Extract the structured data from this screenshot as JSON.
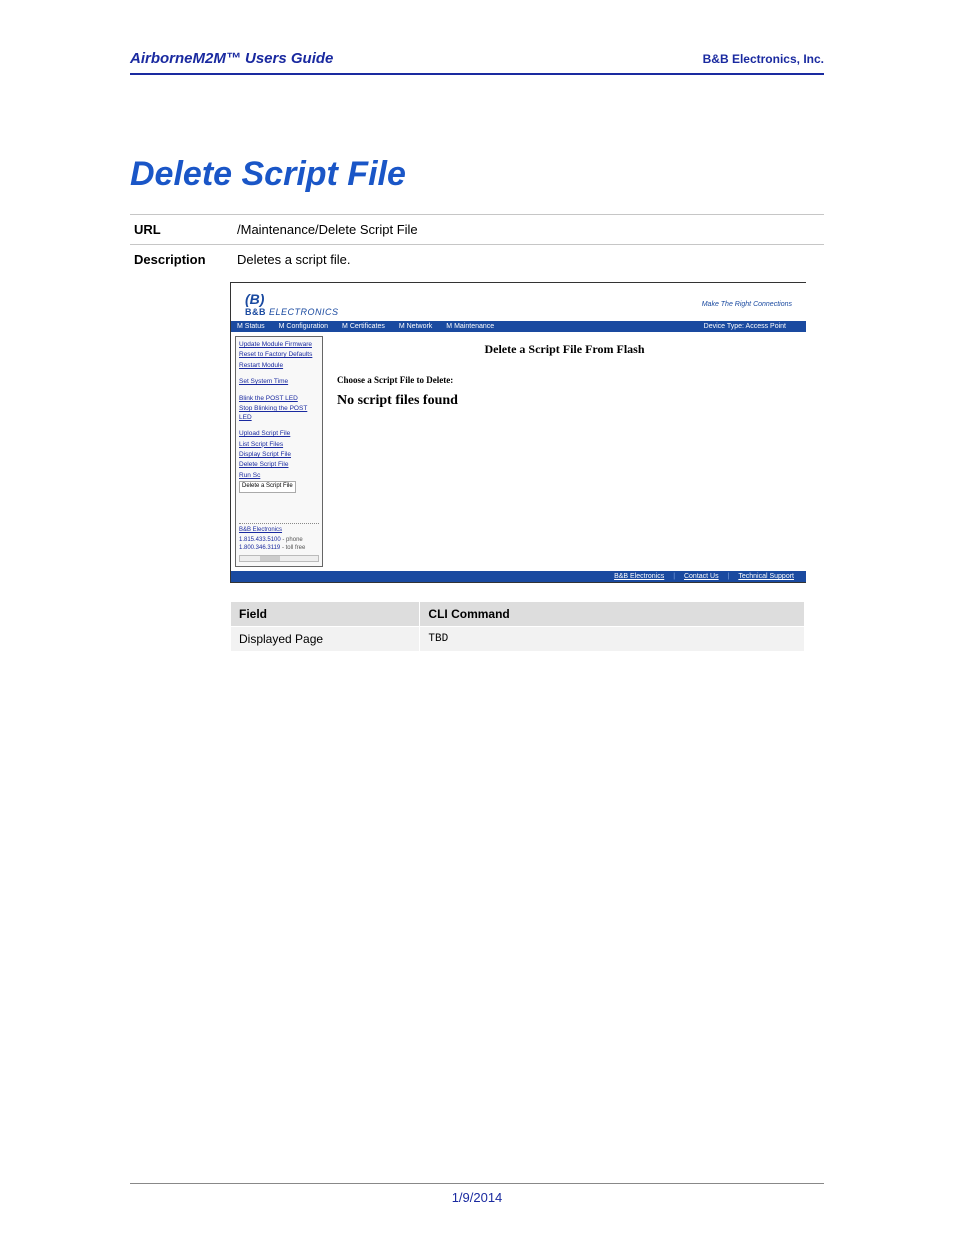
{
  "header": {
    "left": "AirborneM2M™ Users Guide",
    "right": "B&B Electronics, Inc."
  },
  "section_title": "Delete Script File",
  "info_rows": {
    "url": {
      "label": "URL",
      "value": "/Maintenance/Delete Script File"
    },
    "desc": {
      "label": "Description",
      "value": "Deletes a script file."
    }
  },
  "embedded": {
    "logo_b": "(B)",
    "logo_text_a": "B&B",
    "logo_text_b": "ELECTRONICS",
    "tagline": "Make The Right Connections",
    "nav": {
      "items": [
        "M Status",
        "M Configuration",
        "M Certificates",
        "M Network",
        "M Maintenance"
      ],
      "device": "Device Type: Access Point"
    },
    "sidebar": {
      "g1": [
        "Update Module Firmware",
        "Reset to Factory Defaults",
        "Restart Module"
      ],
      "g2": [
        "Set System Time"
      ],
      "g3": [
        "Blink the POST LED",
        "Stop Blinking the POST LED"
      ],
      "g4": [
        "Upload Script File",
        "List Script Files",
        "Display Script File",
        "Delete Script File"
      ],
      "run_label": "Run Sc",
      "tooltip": "Delete a Script File",
      "footer_org": "B&B Electronics",
      "phone1_num": "1.815.433.5100",
      "phone1_lbl": "- phone",
      "phone2_num": "1.800.346.3119",
      "phone2_lbl": "- toll free"
    },
    "main": {
      "title": "Delete a Script File From Flash",
      "choose": "Choose a Script File to Delete:",
      "nofiles": "No script files found"
    },
    "footer": {
      "links": [
        "B&B Electronics",
        "Contact Us",
        "Technical Support"
      ]
    }
  },
  "field_table": {
    "header_field": "Field",
    "header_cli": "CLI Command",
    "row_field": "Displayed Page",
    "row_cli": "TBD"
  },
  "footer_date": "1/9/2014"
}
